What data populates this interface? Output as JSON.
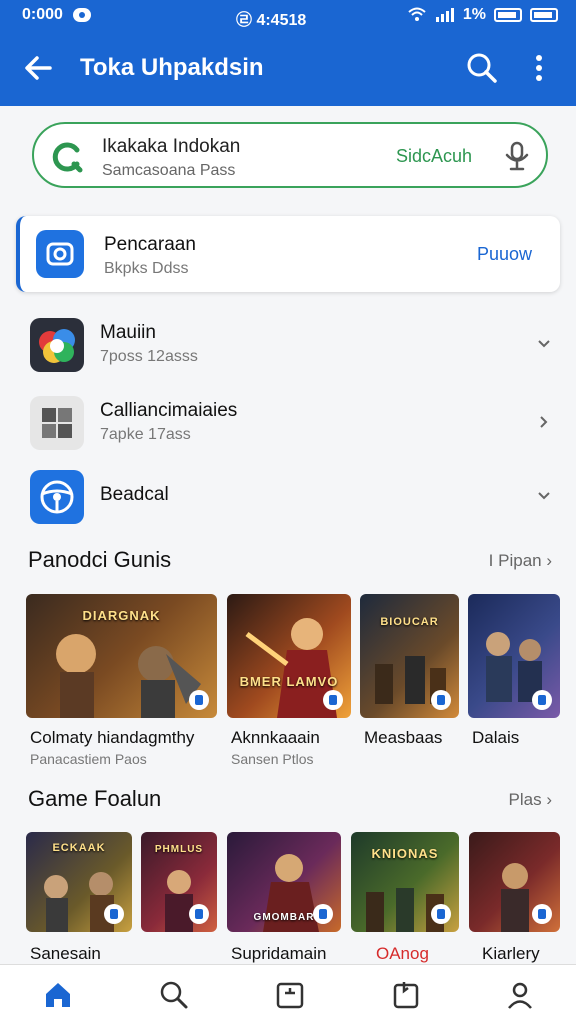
{
  "status": {
    "time": "0:000",
    "center": "㉣ 4:4518",
    "battery": "1%"
  },
  "appbar": {
    "title": "Toka Uhpakdsin"
  },
  "search": {
    "title": "Ikakaka Indokan",
    "subtitle": "Samcasoana Pass",
    "action": "SidcAcuh"
  },
  "featured": {
    "title": "Pencaraan",
    "subtitle": "Bkpks Ddss",
    "action": "Puuow"
  },
  "categories": [
    {
      "title": "Mauiin",
      "subtitle": "7poss 12asss"
    },
    {
      "title": "Calliancimaiaies",
      "subtitle": "7apke 17ass"
    },
    {
      "title": "Beadcal",
      "subtitle": ""
    }
  ],
  "section1": {
    "title": "Panodci Gunis",
    "more": "I Pipan"
  },
  "section1_games": [
    {
      "name": "Colmaty hiandagmthy",
      "subtitle": "Panacastiem Paos",
      "art_text": "DIARGNAK"
    },
    {
      "name": "Aknnkaaain",
      "subtitle": "Sansen Ptlos",
      "art_text": "BMER LAMVO"
    },
    {
      "name": "Measbaas",
      "subtitle": "",
      "art_text": "BIOUCAR"
    },
    {
      "name": "Dalais",
      "subtitle": "",
      "art_text": ""
    }
  ],
  "section2": {
    "title": "Game Foalun",
    "more": "Plas"
  },
  "section2_games": [
    {
      "name": "Sanesain",
      "art_text": "ECKAAK"
    },
    {
      "name": "",
      "art_text": "PHMLUS"
    },
    {
      "name": "Supridamain",
      "art_text": "GMOMBAR"
    },
    {
      "name": "OAnog",
      "art_text": "KNIONAS"
    },
    {
      "name": "Kiarlery",
      "art_text": ""
    }
  ],
  "colors": {
    "primary": "#1a66d2",
    "search_border": "#3aa35b",
    "alert_text": "#d62b2b"
  },
  "icons": {
    "back": "arrow-left-icon",
    "search": "search-icon",
    "more": "more-vert-icon",
    "mic": "mic-icon"
  }
}
